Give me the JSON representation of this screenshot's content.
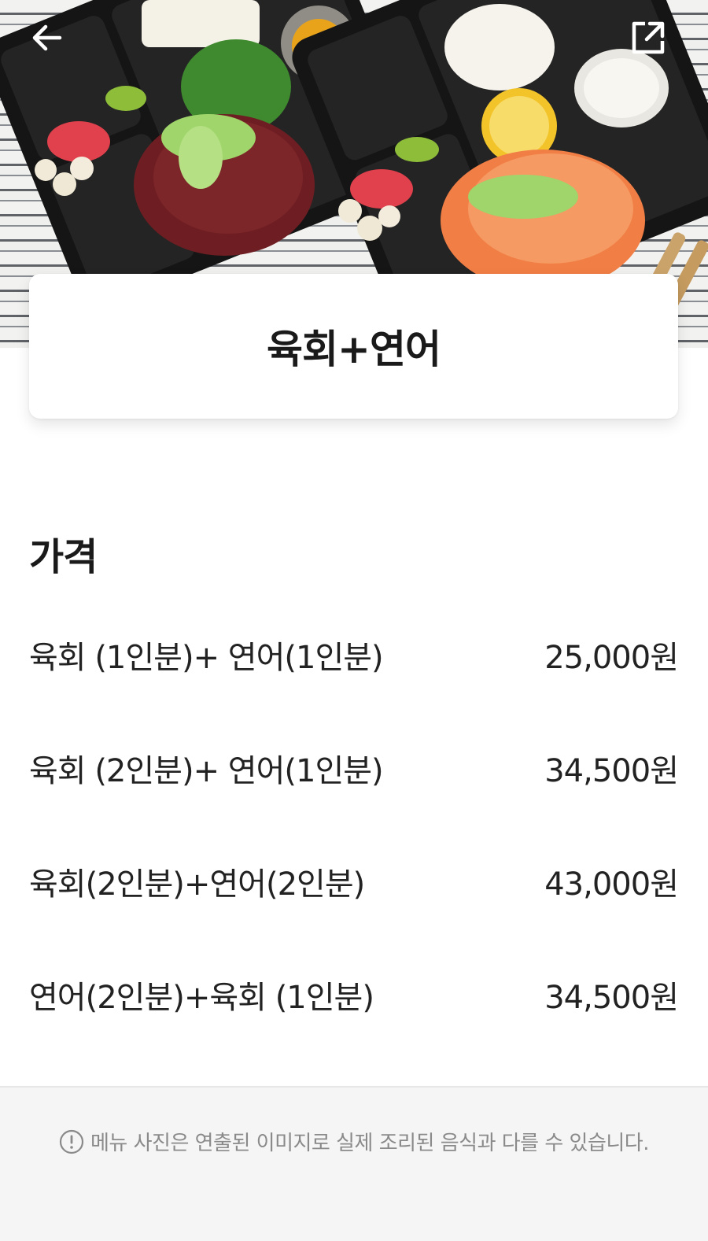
{
  "header": {
    "back_icon": "arrow-left-icon",
    "share_icon": "external-share-icon"
  },
  "menu": {
    "title": "육회+연어"
  },
  "price_section": {
    "heading": "가격",
    "options": [
      {
        "label": "육회 (1인분)+ 연어(1인분)",
        "price": "25,000원"
      },
      {
        "label": "육회 (2인분)+ 연어(1인분)",
        "price": "34,500원"
      },
      {
        "label": "육회(2인분)+연어(2인분)",
        "price": "43,000원"
      },
      {
        "label": "연어(2인분)+육회 (1인분)",
        "price": "34,500원"
      }
    ]
  },
  "notice": {
    "icon": "info-icon",
    "text": "메뉴 사진은 연출된 이미지로 실제 조리된 음식과 다를 수 있습니다."
  },
  "colors": {
    "text_primary": "#1a1a1a",
    "text_muted": "#8a8a8a",
    "footer_bg": "#f5f5f5"
  }
}
